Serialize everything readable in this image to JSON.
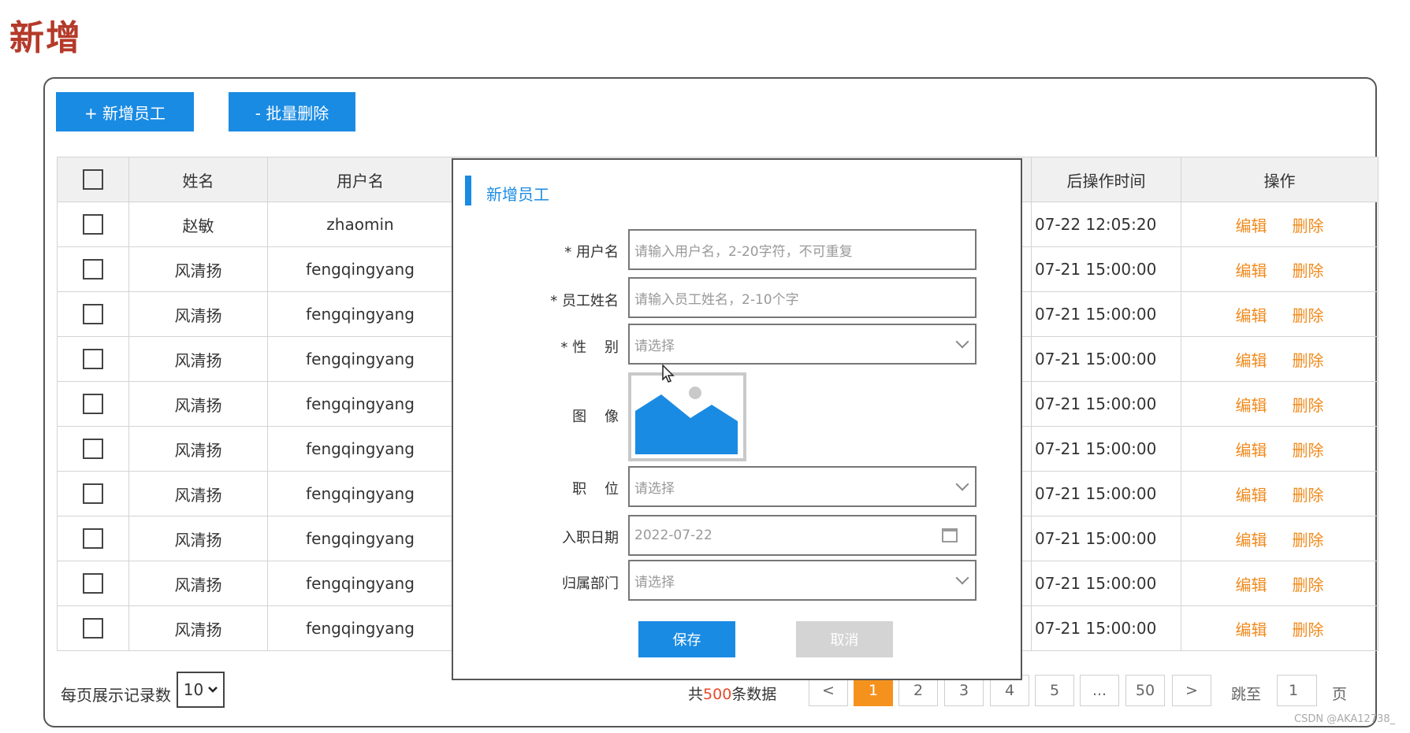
{
  "page": {
    "title": "新增"
  },
  "toolbar": {
    "add_label": "+ 新增员工",
    "batch_delete_label": "- 批量删除"
  },
  "table": {
    "headers": [
      "姓名",
      "用户名",
      "后操作时间",
      "操作"
    ],
    "rows": [
      {
        "name": "赵敏",
        "username": "zhaomin",
        "time": "07-22 12:05:20"
      },
      {
        "name": "风清扬",
        "username": "fengqingyang",
        "time": "07-21 15:00:00"
      },
      {
        "name": "风清扬",
        "username": "fengqingyang",
        "time": "07-21 15:00:00"
      },
      {
        "name": "风清扬",
        "username": "fengqingyang",
        "time": "07-21 15:00:00"
      },
      {
        "name": "风清扬",
        "username": "fengqingyang",
        "time": "07-21 15:00:00"
      },
      {
        "name": "风清扬",
        "username": "fengqingyang",
        "time": "07-21 15:00:00"
      },
      {
        "name": "风清扬",
        "username": "fengqingyang",
        "time": "07-21 15:00:00"
      },
      {
        "name": "风清扬",
        "username": "fengqingyang",
        "time": "07-21 15:00:00"
      },
      {
        "name": "风清扬",
        "username": "fengqingyang",
        "time": "07-21 15:00:00"
      },
      {
        "name": "风清扬",
        "username": "fengqingyang",
        "time": "07-21 15:00:00"
      }
    ],
    "edit_label": "编辑",
    "delete_label": "删除"
  },
  "footer": {
    "page_size_label": "每页展示记录数",
    "page_size": "10",
    "total_prefix": "共",
    "total_count": "500",
    "total_suffix": "条数据",
    "pages": [
      "<",
      "1",
      "2",
      "3",
      "4",
      "5",
      "...",
      "50",
      ">"
    ],
    "active_page": "1",
    "jump_label": "跳至",
    "jump_value": "1",
    "page_suffix": "页"
  },
  "dialog": {
    "title": "新增员工",
    "fields": {
      "username": {
        "label": "* 用户名",
        "placeholder": "请输入用户名，2-20字符，不可重复"
      },
      "employee_name": {
        "label": "* 员工姓名",
        "placeholder": "请输入员工姓名，2-10个字"
      },
      "gender": {
        "label": "* 性    别",
        "placeholder": "请选择"
      },
      "image": {
        "label": "图    像"
      },
      "position": {
        "label": "职    位",
        "placeholder": "请选择"
      },
      "hire_date": {
        "label": "入职日期",
        "value": "2022-07-22"
      },
      "department": {
        "label": "归属部门",
        "placeholder": "请选择"
      }
    },
    "save_label": "保存",
    "cancel_label": "取消"
  },
  "watermark": "CSDN @AKA12738_",
  "colors": {
    "primary": "#1a8be3",
    "accent": "#f5921d",
    "title": "#b43a2a",
    "op_link": "#f08a1c"
  }
}
